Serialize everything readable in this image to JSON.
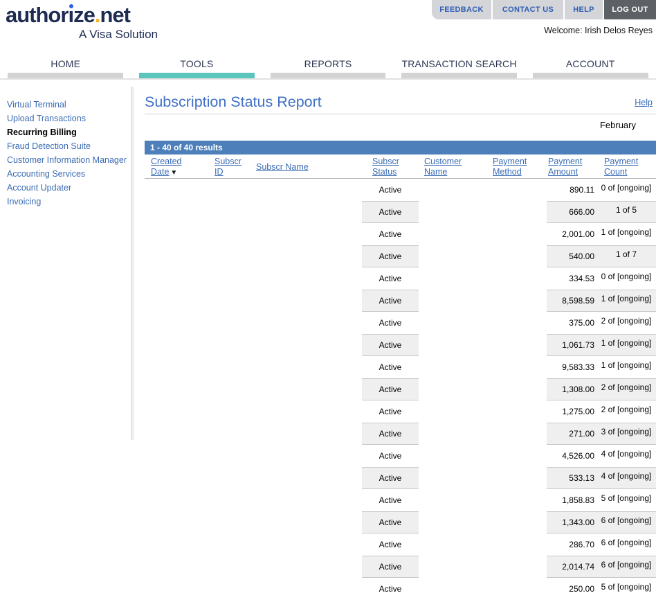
{
  "brand": {
    "logo_prefix": "author",
    "logo_mid": "ze",
    "logo_dot": ".",
    "logo_suffix": "net",
    "tagline": "A Visa Solution",
    "colors": {
      "navy": "#1e2c52",
      "i_dot_blue": "#2a63e8",
      "period_gold": "#f2b41e"
    }
  },
  "top_nav": {
    "buttons": [
      {
        "label": "FEEDBACK"
      },
      {
        "label": "CONTACT US"
      },
      {
        "label": "HELP"
      },
      {
        "label": "LOG OUT"
      }
    ],
    "welcome": "Welcome: Irish Delos Reyes"
  },
  "tabs": [
    {
      "label": "HOME",
      "active": false
    },
    {
      "label": "TOOLS",
      "active": true
    },
    {
      "label": "REPORTS",
      "active": false
    },
    {
      "label": "TRANSACTION SEARCH",
      "active": false
    },
    {
      "label": "ACCOUNT",
      "active": false
    }
  ],
  "sidebar": {
    "items": [
      {
        "label": "Virtual Terminal",
        "active": false
      },
      {
        "label": "Upload Transactions",
        "active": false
      },
      {
        "label": "Recurring Billing",
        "active": true
      },
      {
        "label": "Fraud Detection Suite",
        "active": false
      },
      {
        "label": "Customer Information Manager",
        "active": false
      },
      {
        "label": "Accounting Services",
        "active": false
      },
      {
        "label": "Account Updater",
        "active": false
      },
      {
        "label": "Invoicing",
        "active": false
      }
    ]
  },
  "main": {
    "title": "Subscription Status Report",
    "help_label": "Help",
    "period": "February",
    "results_summary": "1 - 40 of 40 results",
    "table": {
      "headers": [
        "Created Date",
        "Subscr ID",
        "Subscr Name",
        "Subscr Status",
        "Customer Name",
        "Payment Method",
        "Payment Amount",
        "Payment Count"
      ],
      "sort": {
        "column": "Created Date",
        "direction": "descending",
        "arrow": "▼"
      },
      "rows": [
        {
          "status": "Active",
          "amount": "890.11",
          "count": "0 of [ongoing]"
        },
        {
          "status": "Active",
          "amount": "666.00",
          "count": "1 of 5"
        },
        {
          "status": "Active",
          "amount": "2,001.00",
          "count": "1 of [ongoing]"
        },
        {
          "status": "Active",
          "amount": "540.00",
          "count": "1 of 7"
        },
        {
          "status": "Active",
          "amount": "334.53",
          "count": "0 of [ongoing]"
        },
        {
          "status": "Active",
          "amount": "8,598.59",
          "count": "1 of [ongoing]"
        },
        {
          "status": "Active",
          "amount": "375.00",
          "count": "2 of [ongoing]"
        },
        {
          "status": "Active",
          "amount": "1,061.73",
          "count": "1 of [ongoing]"
        },
        {
          "status": "Active",
          "amount": "9,583.33",
          "count": "1 of [ongoing]"
        },
        {
          "status": "Active",
          "amount": "1,308.00",
          "count": "2 of [ongoing]"
        },
        {
          "status": "Active",
          "amount": "1,275.00",
          "count": "2 of [ongoing]"
        },
        {
          "status": "Active",
          "amount": "271.00",
          "count": "3 of [ongoing]"
        },
        {
          "status": "Active",
          "amount": "4,526.00",
          "count": "4 of [ongoing]"
        },
        {
          "status": "Active",
          "amount": "533.13",
          "count": "4 of [ongoing]"
        },
        {
          "status": "Active",
          "amount": "1,858.83",
          "count": "5 of [ongoing]"
        },
        {
          "status": "Active",
          "amount": "1,343.00",
          "count": "6 of [ongoing]"
        },
        {
          "status": "Active",
          "amount": "286.70",
          "count": "6 of [ongoing]"
        },
        {
          "status": "Active",
          "amount": "2,014.74",
          "count": "6 of [ongoing]"
        },
        {
          "status": "Active",
          "amount": "250.00",
          "count": "5 of [ongoing]"
        }
      ]
    }
  },
  "colors": {
    "accent_teal": "#5ac5bd",
    "link_blue": "#3a6bb4",
    "title_blue": "#4171c6",
    "results_bar_blue": "#4d80ba",
    "row_alt_gray": "#efefef",
    "button_gray": "#d4d5d8",
    "logout_gray": "#5d6064"
  }
}
